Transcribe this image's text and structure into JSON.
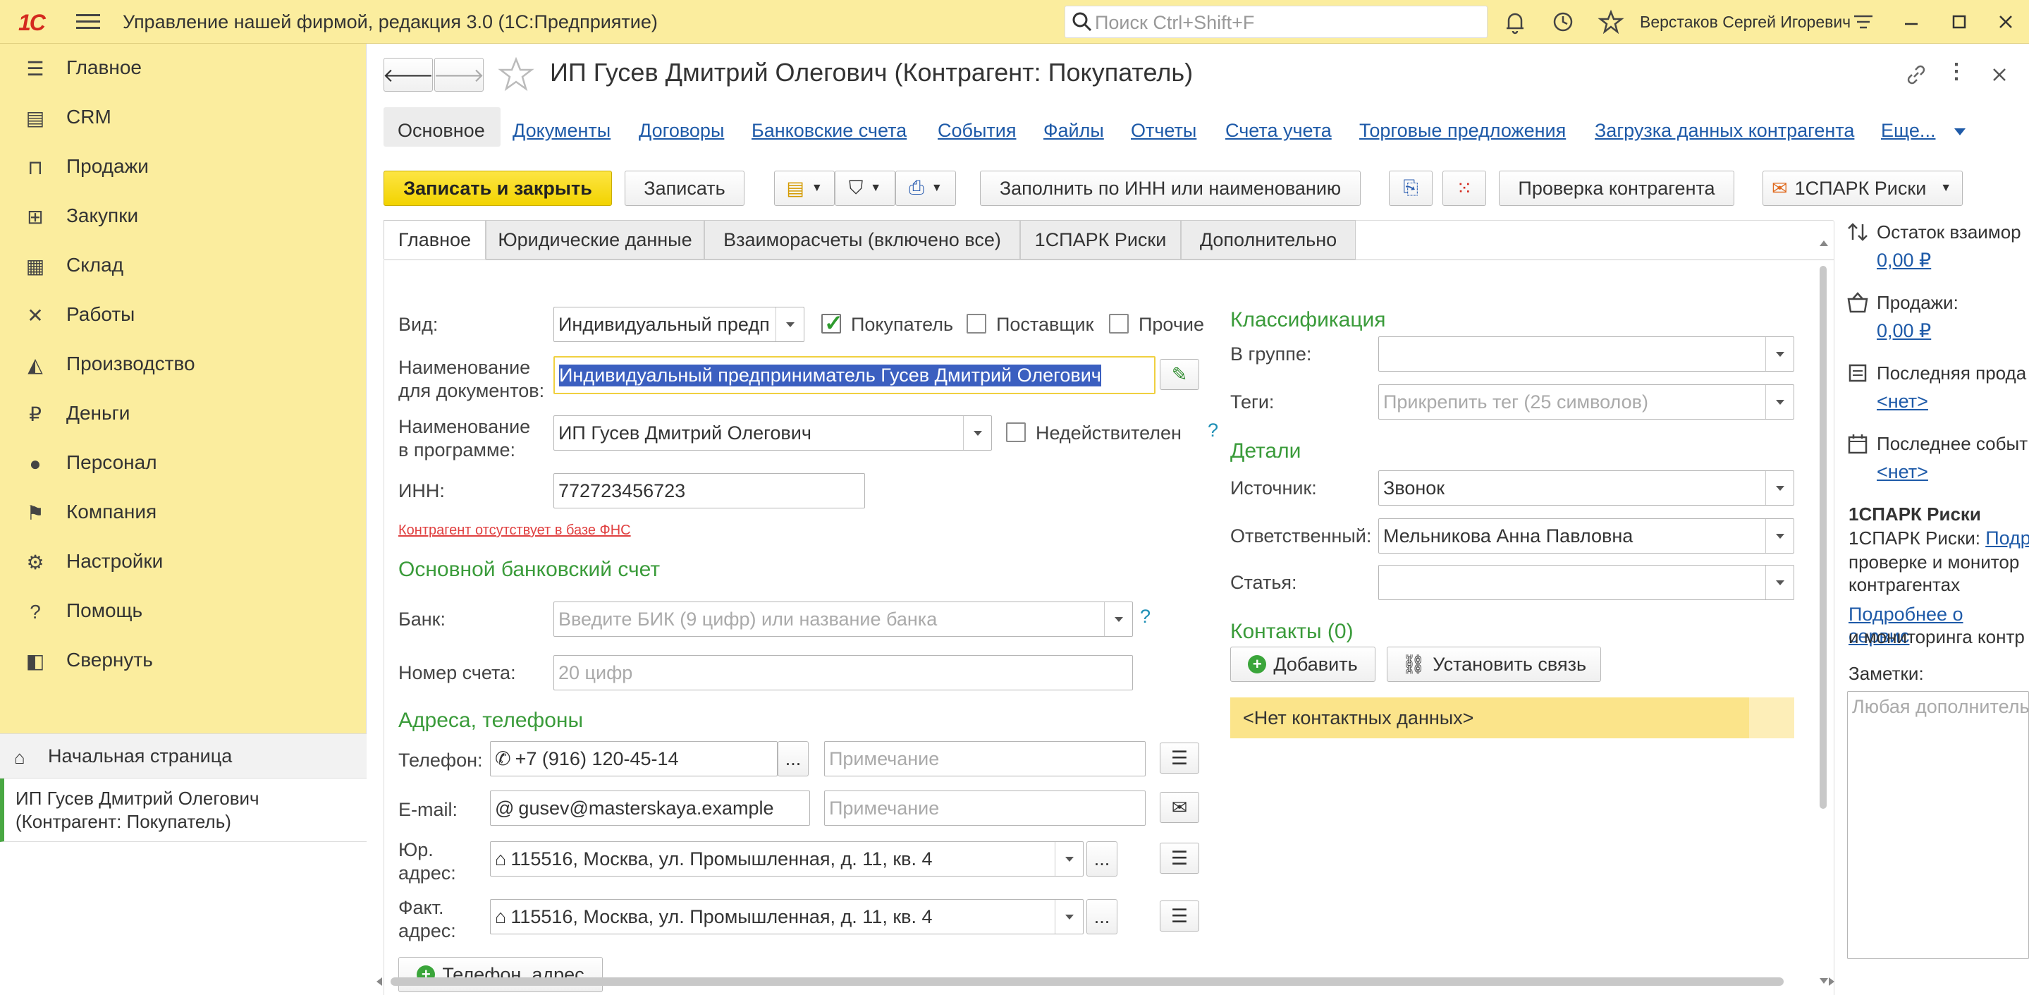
{
  "titlebar": {
    "logo": "1С",
    "app_title": "Управление нашей фирмой, редакция 3.0  (1С:Предприятие)",
    "search_placeholder": "Поиск Ctrl+Shift+F",
    "user": "Верстаков Сергей Игоревич"
  },
  "sidebar": {
    "items": [
      {
        "label": "Главное",
        "icon": "menu-icon"
      },
      {
        "label": "CRM",
        "icon": "crm-icon"
      },
      {
        "label": "Продажи",
        "icon": "basket-icon"
      },
      {
        "label": "Закупки",
        "icon": "cart-icon"
      },
      {
        "label": "Склад",
        "icon": "warehouse-icon"
      },
      {
        "label": "Работы",
        "icon": "tools-icon"
      },
      {
        "label": "Производство",
        "icon": "factory-icon"
      },
      {
        "label": "Деньги",
        "icon": "ruble-icon"
      },
      {
        "label": "Персонал",
        "icon": "person-icon"
      },
      {
        "label": "Компания",
        "icon": "flag-icon"
      },
      {
        "label": "Настройки",
        "icon": "gear-icon"
      },
      {
        "label": "Помощь",
        "icon": "help-icon"
      },
      {
        "label": "Свернуть",
        "icon": "collapse-icon"
      }
    ],
    "home": "Начальная страница",
    "current_line1": "ИП Гусев Дмитрий Олегович",
    "current_line2": "(Контрагент: Покупатель)"
  },
  "form": {
    "title": "ИП Гусев Дмитрий Олегович (Контрагент: Покупатель)",
    "nav_tabs": [
      "Основное",
      "Документы",
      "Договоры",
      "Банковские счета",
      "События",
      "Файлы",
      "Отчеты",
      "Счета учета",
      "Торговые предложения",
      "Загрузка данных контрагента",
      "Еще..."
    ],
    "toolbar": {
      "save_close": "Записать и закрыть",
      "save": "Записать",
      "fill_inn": "Заполнить по ИНН или наименованию",
      "check": "Проверка контрагента",
      "spark": "1СПАРК Риски"
    },
    "tabs": [
      "Главное",
      "Юридические данные",
      "Взаиморасчеты (включено все)",
      "1СПАРК Риски",
      "Дополнительно"
    ],
    "vid_label": "Вид:",
    "vid_value": "Индивидуальный предп",
    "chk_buyer": "Покупатель",
    "chk_supplier": "Поставщик",
    "chk_other": "Прочие",
    "docname_label1": "Наименование",
    "docname_label2": "для документов:",
    "docname_value": "Индивидуальный предприниматель Гусев Дмитрий Олегович",
    "progname_label1": "Наименование",
    "progname_label2": "в программе:",
    "progname_value": "ИП Гусев Дмитрий Олегович",
    "invalid_label": "Недействителен",
    "question": "?",
    "inn_label": "ИНН:",
    "inn_value": "772723456723",
    "fns_warning": "Контрагент отсутствует в базе ФНС",
    "bank_section": "Основной банковский счет",
    "bank_label": "Банк:",
    "bank_placeholder": "Введите БИК (9 цифр) или название банка",
    "account_label": "Номер счета:",
    "account_placeholder": "20 цифр",
    "address_section": "Адреса, телефоны",
    "phone_label": "Телефон:",
    "phone_value": "+7 (916) 120-45-14",
    "note_placeholder": "Примечание",
    "email_label": "E-mail:",
    "email_value": "gusev@masterskaya.example",
    "legal_label1": "Юр.",
    "legal_label2": "адрес:",
    "legal_value": "115516, Москва, ул. Промышленная, д. 11, кв. 4",
    "fact_label1": "Факт.",
    "fact_label2": "адрес:",
    "fact_value": "115516, Москва, ул. Промышленная, д. 11, кв. 4",
    "add_phone_btn": "Телефон, адрес",
    "class_section": "Классификация",
    "group_label": "В группе:",
    "tags_label": "Теги:",
    "tags_placeholder": "Прикрепить тег (25 символов)",
    "details_section": "Детали",
    "source_label": "Источник:",
    "source_value": "Звонок",
    "resp_label": "Ответственный:",
    "resp_value": "Мельникова Анна Павловна",
    "article_label": "Статья:",
    "contacts_section": "Контакты (0)",
    "add_btn": "Добавить",
    "link_btn": "Установить связь",
    "no_contacts": "<Нет контактных данных>"
  },
  "right_panel": {
    "balance_label": "Остаток взаимор",
    "balance_value": "0,00 ₽",
    "sales_label": "Продажи:",
    "sales_value": "0,00 ₽",
    "last_sale_label": "Последняя прода",
    "last_sale_value": "<нет>",
    "last_event_label": "Последнее событ",
    "last_event_value": "<нет>",
    "spark_title": "1СПАРК Риски",
    "spark_line1_prefix": "1СПАРК Риски: ",
    "spark_line1_link": "Подр",
    "spark_line2": "проверке и монитор",
    "spark_line3": "контрагентах",
    "more_link": "Подробнее о сервис",
    "spark_line4": "и мониторинга контр",
    "notes_label": "Заметки:",
    "notes_placeholder": "Любая дополнитель"
  },
  "colors": {
    "accent_yellow": "#fbed9e",
    "section_green": "#3a9b3a",
    "link_blue": "#1e5aa8",
    "logo_red": "#d42a1f"
  }
}
